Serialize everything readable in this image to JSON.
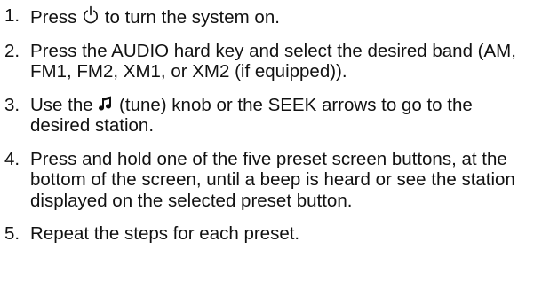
{
  "steps": [
    {
      "number": "1.",
      "before_icon": "Press ",
      "icon": "power-icon",
      "after_icon": " to turn the system on."
    },
    {
      "number": "2.",
      "text": "Press the AUDIO hard key and select the desired band (AM, FM1, FM2, XM1, or XM2 (if equipped))."
    },
    {
      "number": "3.",
      "before_icon": "Use the ",
      "icon": "music-note-icon",
      "after_icon": " (tune) knob or the SEEK arrows to go to the desired station."
    },
    {
      "number": "4.",
      "text": "Press and hold one of the five preset screen buttons, at the bottom of the screen, until a beep is heard or see the station displayed on the selected preset button."
    },
    {
      "number": "5.",
      "text": "Repeat the steps for each preset."
    }
  ]
}
